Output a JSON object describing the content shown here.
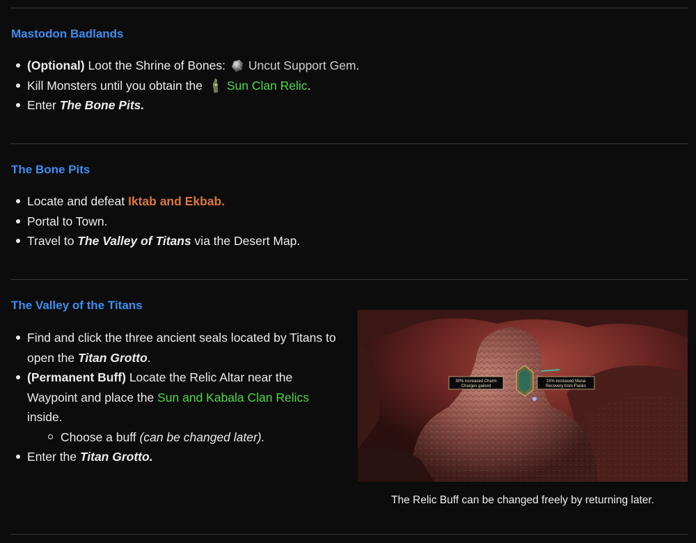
{
  "sections": [
    {
      "title": "Mastodon Badlands",
      "items": [
        {
          "prefix": "(Optional)",
          "text": " Loot the Shrine of Bones: ",
          "icon": "uncut-gem-icon",
          "item": "Uncut Support Gem",
          "suffix": "."
        },
        {
          "text": "Kill Monsters until you obtain the ",
          "icon": "relic-icon",
          "item": "Sun Clan Relic",
          "suffix": "."
        },
        {
          "text": "Enter ",
          "emph": "The Bone Pits."
        }
      ]
    },
    {
      "title": "The Bone Pits",
      "items": [
        {
          "text": "Locate and defeat ",
          "boss": "Iktab and Ekbab."
        },
        {
          "text": "Portal to Town."
        },
        {
          "text": "Travel to ",
          "emph": "The Valley of Titans",
          "suffix": " via the Desert Map."
        }
      ]
    },
    {
      "title": "The Valley of the Titans",
      "items": [
        {
          "text": "Find and click the three ancient seals located by Titans to",
          "text2": "open the ",
          "emph": "Titan Grotto",
          "suffix": "."
        },
        {
          "prefix": "(Permanent Buff)",
          "text": " Locate the Relic Altar near the",
          "text2": "Waypoint and place the ",
          "item": "Sun and Kabala Clan Relics",
          "text3": "inside."
        },
        {
          "text": "Choose a buff ",
          "note": "(can be changed later)."
        },
        {
          "text": "Enter the ",
          "emph": "Titan Grotto."
        }
      ],
      "image": {
        "left_label_1": "30% increased Charm",
        "left_label_2": "Charges gained",
        "right_label_1": "15% increased Mana",
        "right_label_2": "Recovery from Flasks",
        "caption": "The Relic Buff can be changed freely by returning later."
      }
    }
  ],
  "colors": {
    "heading": "#3b8ef0",
    "item_link": "#4cd94c",
    "boss": "#d9763a",
    "uncut_gem_text": "#d0d0d0",
    "background": "#0c0c0c"
  }
}
